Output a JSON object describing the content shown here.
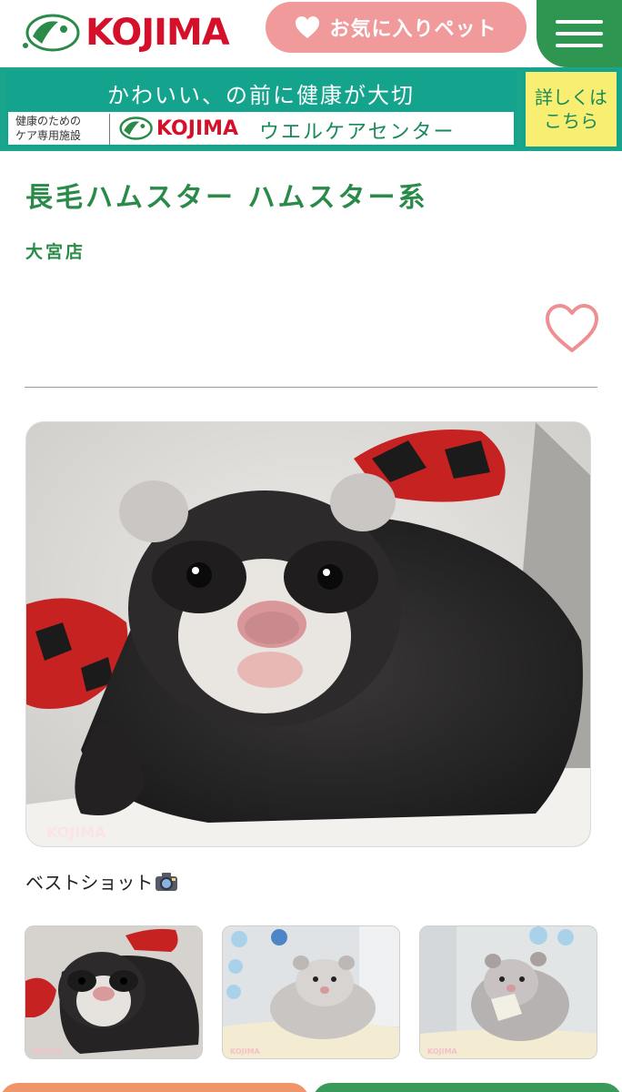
{
  "header": {
    "logo_text": "KOJIMA",
    "favorites_button_label": "お気に入りペット",
    "menu_icon": "hamburger-menu-icon"
  },
  "banner": {
    "headline": "かわいい、の前に健康が大切",
    "facility_line1": "健康のための",
    "facility_line2": "ケア専用施設",
    "logo_text": "KOJIMA",
    "center_name": "ウエルケアセンター",
    "cta_line1": "詳しくは",
    "cta_line2": "こちら"
  },
  "pet": {
    "title": "長毛ハムスター ハムスター系",
    "store": "大宮店",
    "favorite_icon": "heart-outline-icon"
  },
  "photo": {
    "credit": "KOJIMA",
    "caption": "ベストショット"
  },
  "thumbnails": [
    {
      "alt": "ferret-photo",
      "credit": "KOJIMA"
    },
    {
      "alt": "hamster-photo",
      "credit": "KOJIMA"
    },
    {
      "alt": "hamster-eating-photo",
      "credit": "KOJIMA"
    }
  ],
  "colors": {
    "brand_green": "#2a8a48",
    "brand_red": "#d4102b",
    "favorite_pink": "#f19a9c",
    "banner_teal": "#14a38c",
    "cta_yellow": "#f8ef72"
  }
}
